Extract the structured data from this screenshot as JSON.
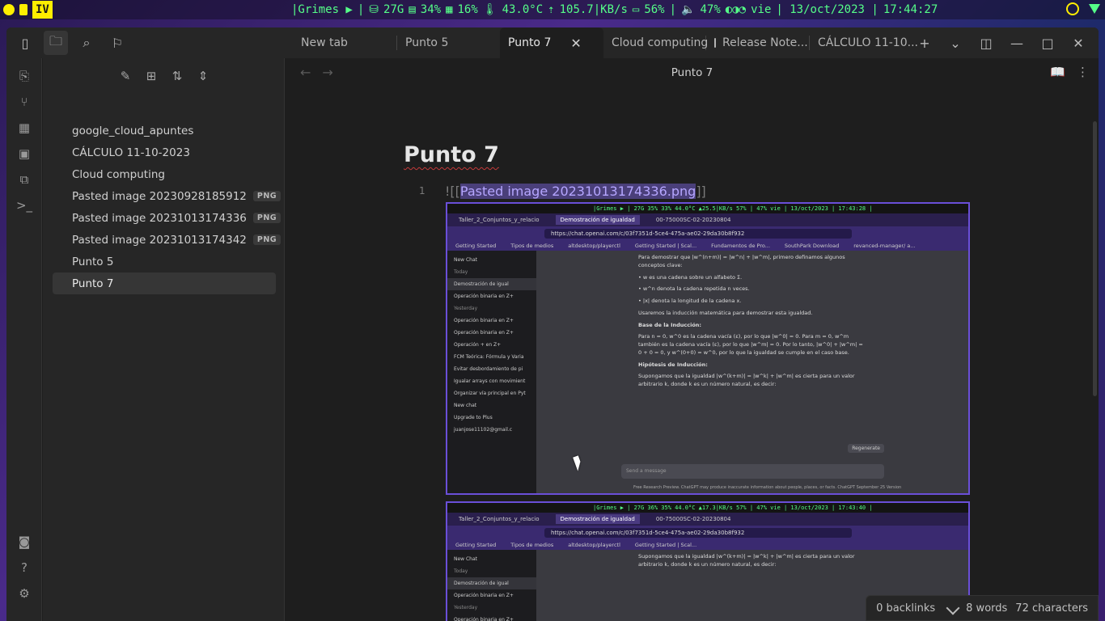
{
  "system_bar": {
    "workspace_label": "IV",
    "music": "|Grimes ▶",
    "disk": "27G",
    "memory": "34%",
    "cpu": "16%",
    "temperature": "43.0°C",
    "network": "105.7|KB/s",
    "battery": "56%",
    "volume": "47%",
    "day": "vie",
    "date": "| 13/oct/2023 |",
    "time": "17:44:27",
    "colors": {
      "accent": "#ffee00",
      "text": "#55ff88"
    }
  },
  "tabs": [
    {
      "label": "New tab"
    },
    {
      "label": "Punto 5"
    },
    {
      "label": "Punto 7",
      "close": "✕"
    },
    {
      "label": "Cloud computing"
    },
    {
      "label": "Release Note..."
    },
    {
      "label": "CÁLCULO 11-10..."
    }
  ],
  "titlebar_icons": [
    "sidebar-toggle-icon",
    "folder-icon",
    "search-icon",
    "bookmark-icon",
    "plus-icon",
    "chevron-down-icon",
    "split-view-icon",
    "minimize-icon",
    "maximize-icon",
    "close-icon"
  ],
  "sidebar": {
    "files": [
      {
        "name": "google_cloud_apuntes",
        "badge": ""
      },
      {
        "name": "CÁLCULO 11-10-2023",
        "badge": ""
      },
      {
        "name": "Cloud computing",
        "badge": ""
      },
      {
        "name": "Pasted image 20230928185912",
        "badge": "PNG"
      },
      {
        "name": "Pasted image 20231013174336",
        "badge": "PNG"
      },
      {
        "name": "Pasted image 20231013174342",
        "badge": "PNG"
      },
      {
        "name": "Punto 5",
        "badge": ""
      },
      {
        "name": "Punto 7",
        "badge": ""
      }
    ],
    "active_file": "Punto 7"
  },
  "editor": {
    "view_title": "Punto 7",
    "doc_title": "Punto 7",
    "line_number": "1",
    "embed_prefix": "![[",
    "embed_name": "Pasted image 20231013174336.png",
    "embed_suffix": "]]"
  },
  "embedded_screenshot_1": {
    "bar": "|Grimes ▶ | 27G 35% 33% 44.0°C ▲25.5|KB/s 57% | 47% vie | 13/oct/2023 | 17:43:28 |",
    "tabs": [
      "Taller_2_Conjuntos_y_relacio",
      "Demostración de igualdad",
      "00-75000SC-02-20230804"
    ],
    "url": "https://chat.openai.com/c/03f7351d-5ce4-475a-ae02-29da30b8f932",
    "bookmarks": [
      "Getting Started",
      "Tipos de medios",
      "altdesktop/playerctl",
      "Getting Started | Scal...",
      "Fundamentos de Pro...",
      "SouthPark Download",
      "revanced-manager/ a..."
    ],
    "side_items": [
      "New Chat",
      "Today",
      "Demostración de igual",
      "Operación binaria en Z+",
      "Yesterday",
      "Operación binaria en Z+",
      "Operación binaria en Z+",
      "Operación + en Z+",
      "FCM Teórica: Fórmula y Varia",
      "Evitar desbordamiento de pi",
      "Igualar arrays con movimient",
      "Organizar vía principal en Pyt",
      "New chat",
      "Upgrade to Plus",
      "juanjose11102@gmail.c"
    ],
    "content": [
      "Para demostrar que |w^(n+m)| = |w^n| + |w^m|, primero definamos algunos conceptos clave:",
      "• w es una cadena sobre un alfabeto Σ.",
      "• w^n denota la cadena repetida n veces.",
      "• |x| denota la longitud de la cadena x.",
      "Usaremos la inducción matemática para demostrar esta igualdad.",
      "Base de la Inducción:",
      "Para n = 0, w^0 es la cadena vacía (ε), por lo que |w^0| = 0. Para m = 0, w^m también es la cadena vacía (ε), por lo que |w^m| = 0. Por lo tanto, |w^0| + |w^m| = 0 + 0 = 0, y w^(0+0) = w^0, por lo que la igualdad se cumple en el caso base.",
      "Hipótesis de Inducción:",
      "Supongamos que la igualdad |w^(k+m)| = |w^k| + |w^m| es cierta para un valor arbitrario k, donde k es un número natural, es decir:"
    ],
    "input_placeholder": "Send a message",
    "regenerate": "Regenerate",
    "footer": "Free Research Preview. ChatGPT may produce inaccurate information about people, places, or facts. ChatGPT September 25 Version"
  },
  "embedded_screenshot_2": {
    "bar": "|Grimes ▶ | 27G 36% 35% 44.0°C ▲17.3|KB/s 57% | 47% vie | 13/oct/2023 | 17:43:40 |",
    "content": [
      "Supongamos que la igualdad |w^(k+m)| = |w^k| + |w^m| es cierta para un valor arbitrario k, donde k es un número natural, es decir:"
    ],
    "side_items": [
      "New Chat",
      "Today",
      "Demostración de igual",
      "Operación binaria en Z+",
      "Yesterday",
      "Operación binaria en Z+"
    ]
  },
  "status_bar": {
    "backlinks": "0 backlinks",
    "words": "8 words",
    "characters": "72 characters"
  }
}
